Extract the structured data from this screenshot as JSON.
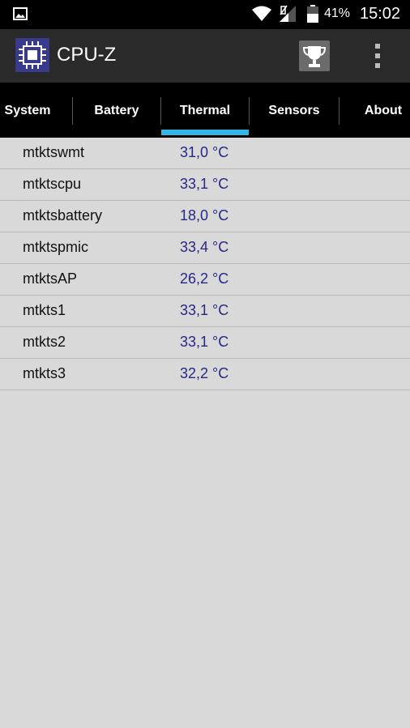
{
  "status_bar": {
    "battery_percent": "41%",
    "time": "15:02",
    "icons": [
      "gallery-icon",
      "wifi-icon",
      "signal-icon",
      "battery-icon"
    ]
  },
  "app_bar": {
    "title": "CPU-Z",
    "icons": [
      "cpu-chip-icon",
      "trophy-icon",
      "more-vert-icon"
    ]
  },
  "tabs": [
    {
      "label": "System"
    },
    {
      "label": "Battery"
    },
    {
      "label": "Thermal",
      "selected": true
    },
    {
      "label": "Sensors"
    },
    {
      "label": "About"
    }
  ],
  "thermal": [
    {
      "name": "mtktswmt",
      "value": "31,0 °C"
    },
    {
      "name": "mtktscpu",
      "value": "33,1 °C"
    },
    {
      "name": "mtktsbattery",
      "value": "18,0 °C"
    },
    {
      "name": "mtktspmic",
      "value": "33,4 °C"
    },
    {
      "name": "mtktsAP",
      "value": "26,2 °C"
    },
    {
      "name": "mtkts1",
      "value": "33,1 °C"
    },
    {
      "name": "mtkts2",
      "value": "33,1 °C"
    },
    {
      "name": "mtkts3",
      "value": "32,2 °C"
    }
  ],
  "colors": {
    "tab_indicator": "#33b5e5",
    "value_text": "#272885",
    "background": "#d9d9d9"
  }
}
